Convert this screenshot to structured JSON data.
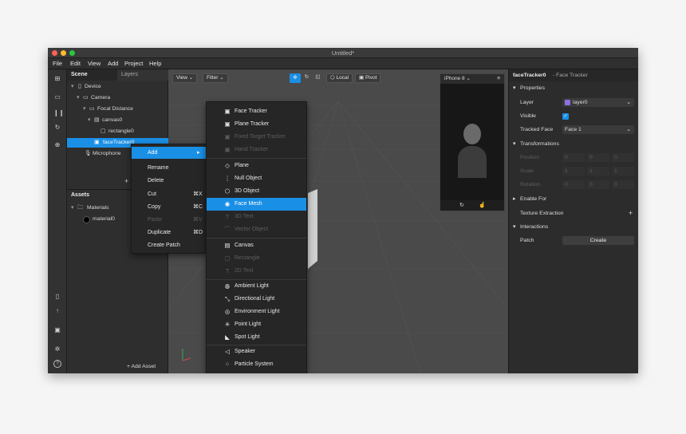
{
  "window": {
    "title": "Untitled*"
  },
  "menu": [
    "File",
    "Edit",
    "View",
    "Add",
    "Project",
    "Help"
  ],
  "scene": {
    "tab_scene": "Scene",
    "tab_layers": "Layers",
    "tree": [
      {
        "label": "Device",
        "icon": "device-icon"
      },
      {
        "label": "Camera",
        "icon": "camera-icon"
      },
      {
        "label": "Focal Distance",
        "icon": "focal-distance-icon"
      },
      {
        "label": "canvas0",
        "icon": "canvas-icon"
      },
      {
        "label": "rectangle0",
        "icon": "rectangle-icon"
      },
      {
        "label": "faceTracker0",
        "icon": "face-tracker-icon"
      },
      {
        "label": "Microphone",
        "icon": "microphone-icon"
      }
    ],
    "add_plus": "+",
    "assets_title": "Assets",
    "assets": [
      {
        "label": "Materials"
      },
      {
        "label": "material0"
      }
    ],
    "add_asset": "+ Add Asset"
  },
  "toolbar": {
    "view": "View",
    "filter": "Filter",
    "local": "Local",
    "pivot": "Pivot"
  },
  "preview": {
    "device": "iPhone 8"
  },
  "context_menu": [
    {
      "label": "Add",
      "shortcut": "▸",
      "active": true
    },
    {
      "label": "Rename",
      "shortcut": ""
    },
    {
      "label": "Delete",
      "shortcut": ""
    },
    {
      "label": "Cut",
      "shortcut": "⌘X"
    },
    {
      "label": "Copy",
      "shortcut": "⌘C"
    },
    {
      "label": "Paste",
      "shortcut": "⌘V",
      "disabled": true
    },
    {
      "label": "Duplicate",
      "shortcut": "⌘D"
    },
    {
      "label": "Create Patch",
      "shortcut": ""
    }
  ],
  "submenu": [
    {
      "label": "Face Tracker",
      "icon": "▣"
    },
    {
      "label": "Plane Tracker",
      "icon": "▣"
    },
    {
      "label": "Fixed Target Tracker",
      "icon": "▣",
      "disabled": true
    },
    {
      "label": "Hand Tracker",
      "icon": "▣",
      "disabled": true
    },
    {
      "label": "Plane",
      "icon": "◇",
      "sep_before": true
    },
    {
      "label": "Null Object",
      "icon": "⋮"
    },
    {
      "label": "3D Object",
      "icon": "⬡"
    },
    {
      "label": "Face Mesh",
      "icon": "◉",
      "active": true
    },
    {
      "label": "3D Text",
      "icon": "T",
      "disabled": true
    },
    {
      "label": "Vector Object",
      "icon": "⌒",
      "disabled": true
    },
    {
      "label": "Canvas",
      "icon": "▤",
      "sep_before": true
    },
    {
      "label": "Rectangle",
      "icon": "▢",
      "disabled": true
    },
    {
      "label": "2D Text",
      "icon": "T",
      "disabled": true
    },
    {
      "label": "Ambient Light",
      "icon": "◍",
      "sep_before": true
    },
    {
      "label": "Directional Light",
      "icon": "⤡"
    },
    {
      "label": "Environment Light",
      "icon": "◎"
    },
    {
      "label": "Point Light",
      "icon": "✳"
    },
    {
      "label": "Spot Light",
      "icon": "◣"
    },
    {
      "label": "Speaker",
      "icon": "◁",
      "sep_before": true
    },
    {
      "label": "Particle System",
      "icon": "⁘"
    }
  ],
  "properties": {
    "object_name": "faceTracker0",
    "object_type": "- Face Tracker",
    "section_properties": "Properties",
    "layer_label": "Layer",
    "layer_value": "layer0",
    "visible_label": "Visible",
    "tracked_face_label": "Tracked Face",
    "tracked_face_value": "Face 1",
    "section_transformations": "Transformations",
    "position_label": "Position",
    "scale_label": "Scale",
    "rotation_label": "Rotation",
    "position_values": [
      "0",
      "0",
      "0"
    ],
    "scale_values": [
      "1",
      "1",
      "1"
    ],
    "rotation_values": [
      "0",
      "0",
      "0"
    ],
    "enable_for": "Enable For",
    "texture_extraction": "Texture Extraction",
    "texture_plus": "+",
    "section_interactions": "Interactions",
    "patch_label": "Patch",
    "create_button": "Create"
  },
  "colors": {
    "accent": "#1a8fe6",
    "layer_swatch": "#8f6fe0"
  }
}
